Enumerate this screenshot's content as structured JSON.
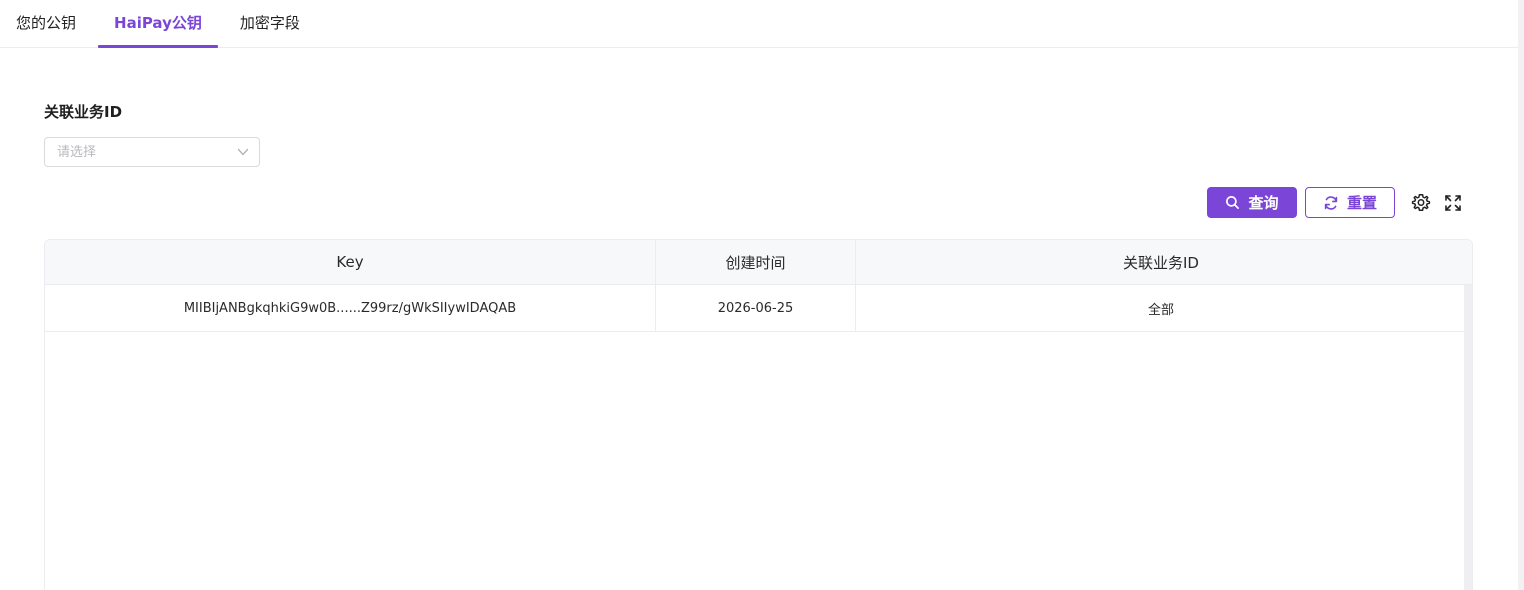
{
  "tabs": [
    {
      "label": "您的公钥",
      "active": false
    },
    {
      "label": "HaiPay公钥",
      "active": true
    },
    {
      "label": "加密字段",
      "active": false
    }
  ],
  "filter": {
    "label": "关联业务ID",
    "placeholder": "请选择"
  },
  "toolbar": {
    "query_label": "查询",
    "reset_label": "重置",
    "settings_icon": "gear-icon",
    "fullscreen_icon": "fullscreen-icon"
  },
  "table": {
    "columns": [
      "Key",
      "创建时间",
      "关联业务ID"
    ],
    "rows": [
      [
        "MIIBIjANBgkqhkiG9w0B......Z99rz/gWkSIIywIDAQAB",
        "2026-06-25",
        "全部"
      ]
    ]
  },
  "colors": {
    "accent": "#7b45d8",
    "header_bg": "#f7f8fa",
    "border": "#ececf0"
  }
}
